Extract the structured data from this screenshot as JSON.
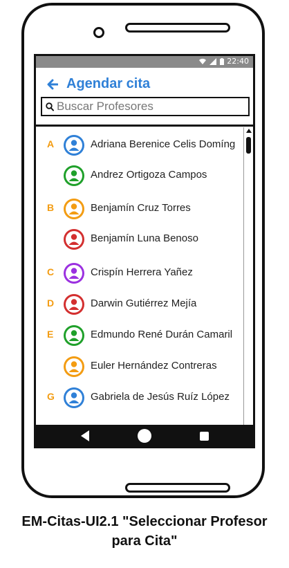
{
  "status_bar": {
    "time": "22:40"
  },
  "appbar": {
    "title": "Agendar cita"
  },
  "search": {
    "placeholder": "Buscar Profesores"
  },
  "contacts": [
    {
      "letter": "A",
      "name": "Adriana Berenice Celis Domíng",
      "color": "#2f80d7"
    },
    {
      "letter": "",
      "name": "Andrez Ortigoza Campos",
      "color": "#1fa02a"
    },
    {
      "letter": "B",
      "name": "Benjamín Cruz Torres",
      "color": "#f39c12"
    },
    {
      "letter": "",
      "name": "Benjamín Luna Benoso",
      "color": "#d32f2f"
    },
    {
      "letter": "C",
      "name": "Crispín Herrera Yañez",
      "color": "#9b30e0"
    },
    {
      "letter": "D",
      "name": "Darwin Gutiérrez Mejía",
      "color": "#d32f2f"
    },
    {
      "letter": "E",
      "name": "Edmundo René Durán Camaril",
      "color": "#1fa02a"
    },
    {
      "letter": "",
      "name": "Euler Hernández Contreras",
      "color": "#f39c12"
    },
    {
      "letter": "G",
      "name": "Gabriela de Jesús Ruíz López",
      "color": "#2f80d7"
    }
  ],
  "caption": {
    "line1": "EM-Citas-UI2.1 \"Seleccionar Profesor",
    "line2": "para Cita\""
  },
  "colors": {
    "accent": "#2f80d7",
    "letter": "#f39c12"
  }
}
